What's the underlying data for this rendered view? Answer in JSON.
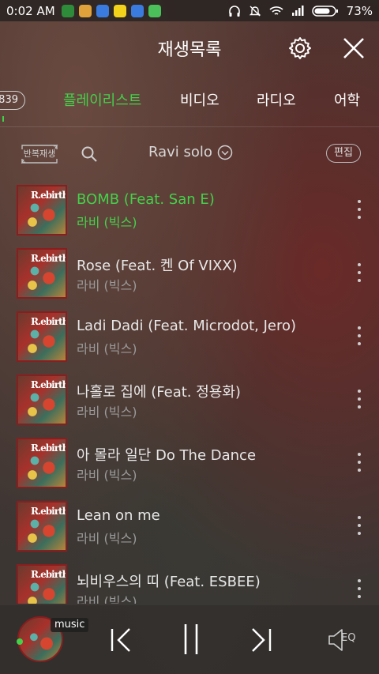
{
  "status_bar": {
    "time": "0:02 AM",
    "battery": "73%"
  },
  "header": {
    "title": "재생목록"
  },
  "tabs": {
    "count_badge": "839",
    "items": [
      {
        "label": "플레이리스트",
        "active": true
      },
      {
        "label": "비디오",
        "active": false
      },
      {
        "label": "라디오",
        "active": false
      },
      {
        "label": "어학",
        "active": false
      }
    ]
  },
  "toolbar": {
    "repeat_label": "반복재생",
    "playlist_name": "Ravi solo",
    "edit_label": "편집"
  },
  "tracks": [
    {
      "title": "BOMB (Feat. San E)",
      "artist": "라비 (빅스)",
      "playing": true
    },
    {
      "title": "Rose (Feat. 켄 Of VIXX)",
      "artist": "라비 (빅스)",
      "playing": false
    },
    {
      "title": "Ladi Dadi (Feat. Microdot, Jero)",
      "artist": "라비 (빅스)",
      "playing": false
    },
    {
      "title": "나홀로 집에 (Feat. 정용화)",
      "artist": "라비 (빅스)",
      "playing": false
    },
    {
      "title": "아 몰라 일단 Do The Dance",
      "artist": "라비 (빅스)",
      "playing": false
    },
    {
      "title": "Lean on me",
      "artist": "라비 (빅스)",
      "playing": false
    },
    {
      "title": "뇌비우스의 띠 (Feat. ESBEE)",
      "artist": "라비 (빅스)",
      "playing": false
    }
  ],
  "album_art_text": "R.ebirth",
  "player": {
    "tag": "music",
    "eq_label": "EQ"
  },
  "colors": {
    "accent": "#44d14a",
    "artist_text": "#9a9a9a"
  }
}
